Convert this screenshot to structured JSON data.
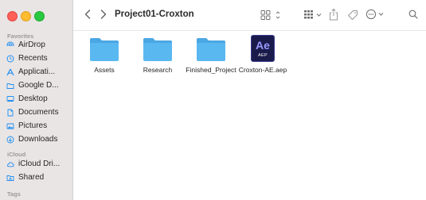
{
  "window": {
    "title": "Project01-Croxton"
  },
  "sidebar": {
    "sections": [
      {
        "header": "Favorites"
      },
      {
        "header": "iCloud"
      },
      {
        "header": "Tags"
      }
    ],
    "favorites": [
      {
        "label": "AirDrop",
        "icon": "airdrop-icon"
      },
      {
        "label": "Recents",
        "icon": "clock-icon"
      },
      {
        "label": "Applicati...",
        "icon": "applications-icon"
      },
      {
        "label": "Google D...",
        "icon": "folder-icon"
      },
      {
        "label": "Desktop",
        "icon": "desktop-icon"
      },
      {
        "label": "Documents",
        "icon": "document-icon"
      },
      {
        "label": "Pictures",
        "icon": "pictures-icon"
      },
      {
        "label": "Downloads",
        "icon": "download-icon"
      }
    ],
    "icloud": [
      {
        "label": "iCloud Dri...",
        "icon": "cloud-icon"
      },
      {
        "label": "Shared",
        "icon": "shared-folder-icon"
      }
    ]
  },
  "files": [
    {
      "name": "Assets",
      "kind": "folder"
    },
    {
      "name": "Research",
      "kind": "folder"
    },
    {
      "name": "Finished_Project",
      "kind": "folder"
    },
    {
      "name": "Croxton-AE.aep",
      "kind": "aep",
      "badge": "Ae",
      "ext": "AEP"
    }
  ],
  "colors": {
    "accent": "#1f8ef1",
    "folder": "#5ab8f0",
    "sidebar_bg": "#eae5e5",
    "ae_bg": "#1a1b4b",
    "ae_logo": "#9999ff"
  }
}
